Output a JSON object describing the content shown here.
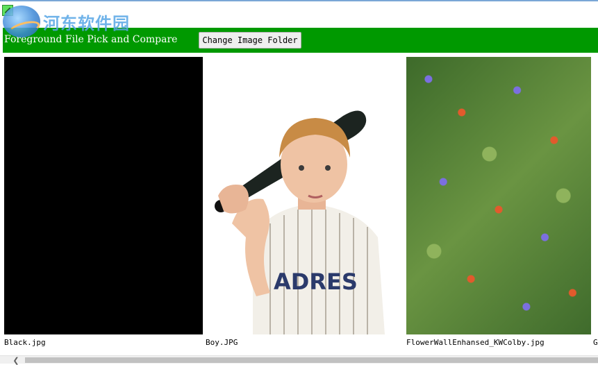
{
  "watermark": {
    "text": "河东软件园"
  },
  "header": {
    "title": "Foreground File Pick and Compare",
    "change_folder_label": "Change Image Folder"
  },
  "images": [
    {
      "caption": "Black.jpg"
    },
    {
      "caption": "Boy.JPG"
    },
    {
      "caption": "FlowerWallEnhansed_KWColby.jpg"
    },
    {
      "caption": "G"
    }
  ],
  "colors": {
    "header_bg": "#009900"
  },
  "icons": {
    "app": "app-icon",
    "scroll_left": "chevron-left-icon"
  }
}
